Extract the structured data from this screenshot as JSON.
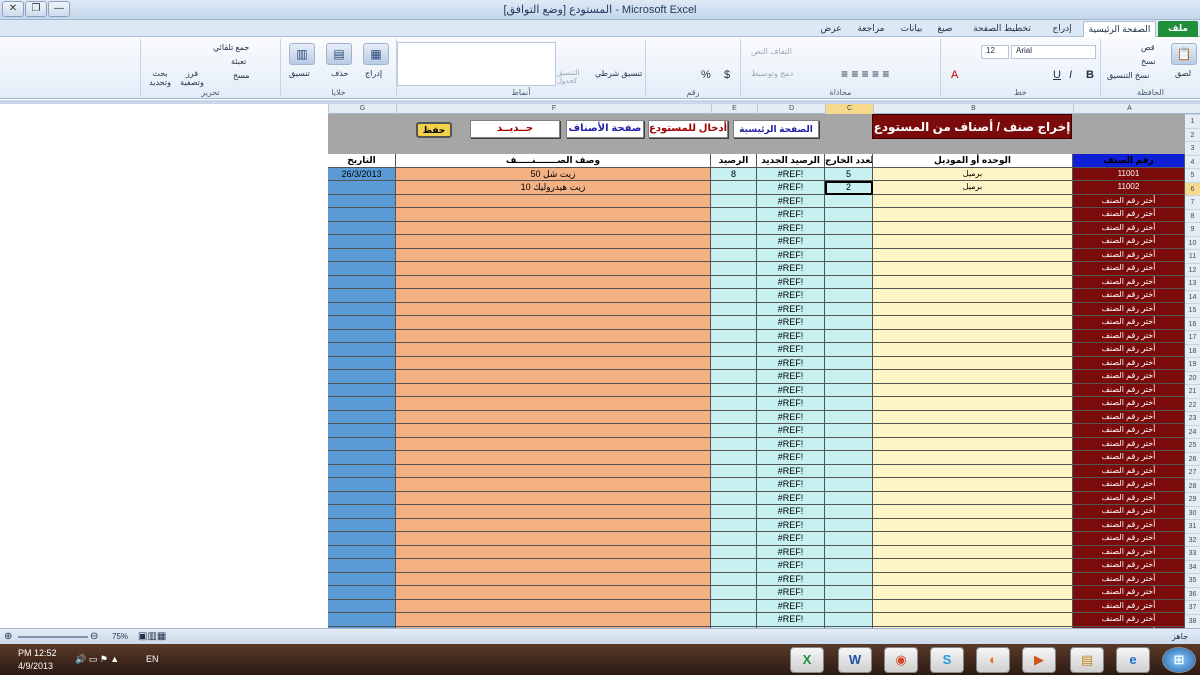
{
  "window": {
    "title": "المستودع  [وضع التوافق] - Microsoft Excel",
    "controls": {
      "close": "✕",
      "restore": "❐",
      "minimize": "—"
    }
  },
  "ribbon_tabs": [
    "ملف",
    "الصفحة الرئيسية",
    "إدراج",
    "تخطيط الصفحة",
    "صيغ",
    "بيانات",
    "مراجعة",
    "عرض"
  ],
  "ribbon": {
    "clipboard": {
      "group": "الحافظة",
      "paste": "لصق",
      "cut": "قص",
      "copy": "نسخ",
      "format_painter": "نسخ التنسيق"
    },
    "font": {
      "group": "خط",
      "name": "Arial",
      "size": "12",
      "bold": "B",
      "italic": "I",
      "underline": "U"
    },
    "alignment": {
      "group": "محاذاة",
      "wrap": "التفاف النص",
      "merge": "دمج وتوسيط"
    },
    "number": {
      "group": "رقم",
      "currency": "$",
      "percent": "%"
    },
    "styles": {
      "group": "أنماط",
      "conditional": "تنسيق شرطي",
      "table": "التنسيق كجدول"
    },
    "cells": {
      "group": "خلايا",
      "insert": "إدراج",
      "delete": "حذف",
      "format": "تنسيق"
    },
    "editing": {
      "group": "تحرير",
      "autosum": "جمع تلقائي",
      "fill": "تعبئة",
      "clear": "مسح",
      "sort": "فرز وتصفية",
      "find": "بحث وتحديد"
    }
  },
  "columns": [
    "G",
    "F",
    "E",
    "D",
    "C",
    "B",
    "A"
  ],
  "selected_column": "C",
  "selected_row": 6,
  "sheet": {
    "title_box": "إخراج صنف / أصناف من المستودع",
    "buttons": {
      "main": "الصفحة الرئيسية",
      "stock_in": "أدخال للمستودع",
      "items": "صفحة الأصناف",
      "new": "جــديــد",
      "save": "حفظ"
    },
    "headers": {
      "date": "التاريخ",
      "description": "وصف الصـــــــنـــــف",
      "balance": "الرصيد",
      "new_balance": "الرصيد الجديد",
      "out_qty": "العدد الخارج",
      "unit": "الوحده أو الموديل",
      "item_no": "رقم الصنف"
    },
    "data_rows": [
      {
        "row": 5,
        "date": "26/3/2013",
        "description": "زيت شل 50",
        "balance": "8",
        "new_balance": "#REF!",
        "out_qty": "5",
        "unit": "برميل",
        "item_no": "11001"
      },
      {
        "row": 6,
        "date": "",
        "description": "زيت هيدروليك 10",
        "balance": "",
        "new_balance": "#REF!",
        "out_qty": "2",
        "unit": "برميل",
        "item_no": "11002"
      }
    ],
    "empty_new_balance": "#REF!",
    "empty_item_prompt": "أختر رقم الصنف",
    "empty_row_start": 7,
    "empty_row_end": 39
  },
  "status": {
    "ready": "جاهز",
    "zoom": "75%"
  },
  "taskbar": {
    "time": "PM 12:52",
    "date": "4/9/2013",
    "lang": "EN"
  }
}
